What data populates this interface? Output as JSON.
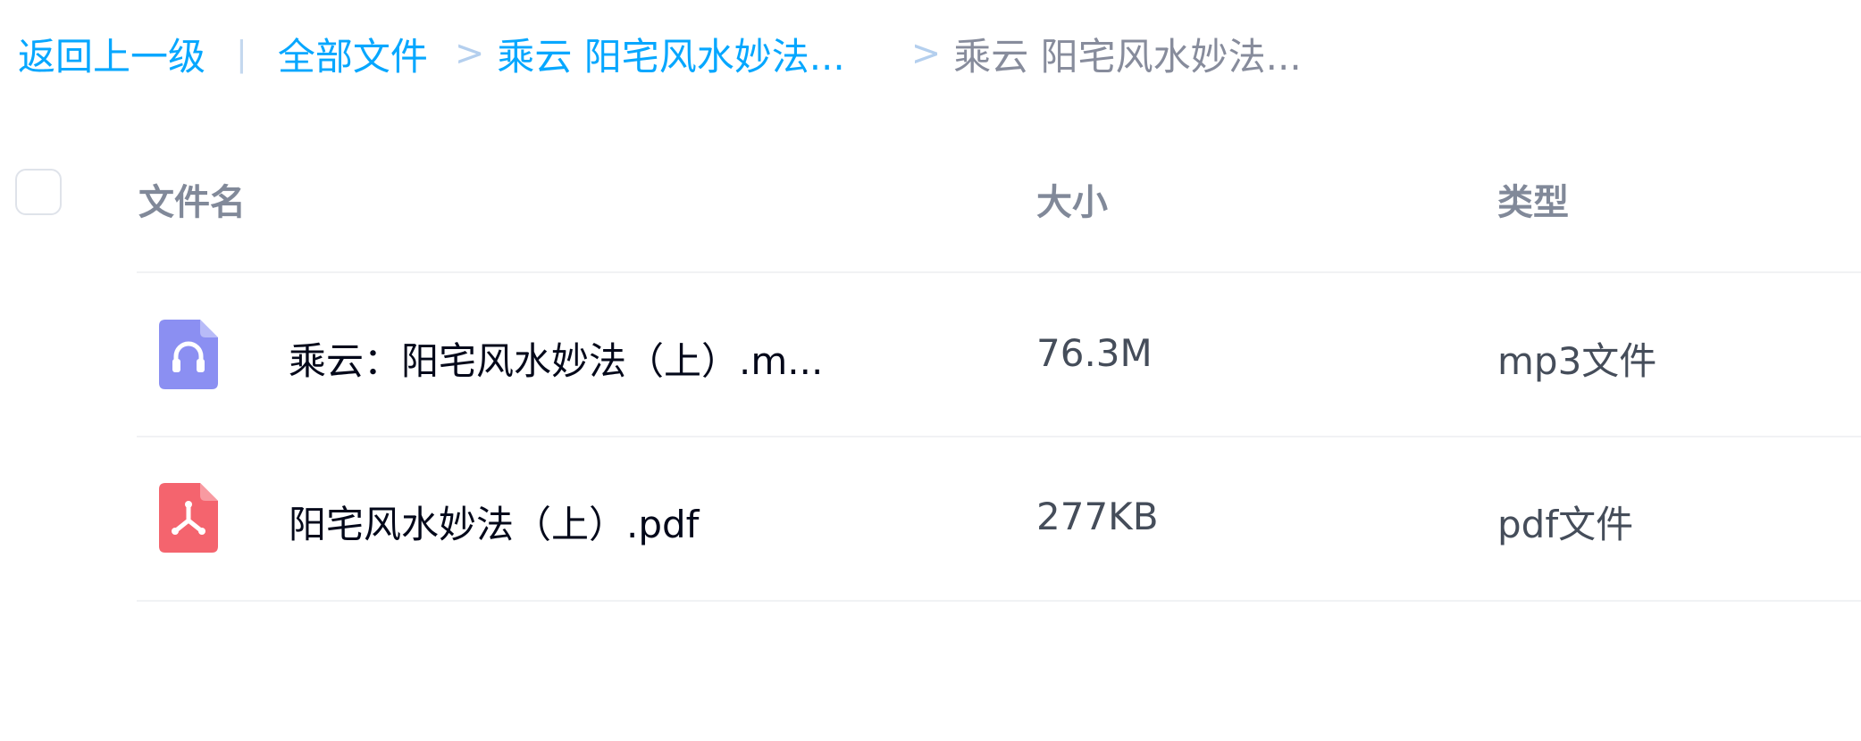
{
  "breadcrumb": {
    "back": "返回上一级",
    "divider": "|",
    "all_files": "全部文件",
    "separator": ">",
    "parent_folder": "乘云 阳宅风水妙法...",
    "current_folder": "乘云 阳宅风水妙法..."
  },
  "table": {
    "columns": {
      "name": "文件名",
      "size": "大小",
      "type": "类型"
    },
    "rows": [
      {
        "name": "乘云：阳宅风水妙法（上）.m...",
        "size": "76.3M",
        "type": "mp3文件",
        "icon": "audio-file-icon",
        "icon_color": "#8b8ff2"
      },
      {
        "name": "阳宅风水妙法（上）.pdf",
        "size": "277KB",
        "type": "pdf文件",
        "icon": "pdf-file-icon",
        "icon_color": "#f4646e"
      }
    ]
  },
  "colors": {
    "link": "#06a7ff",
    "muted": "#878c9c",
    "header": "#818999"
  }
}
